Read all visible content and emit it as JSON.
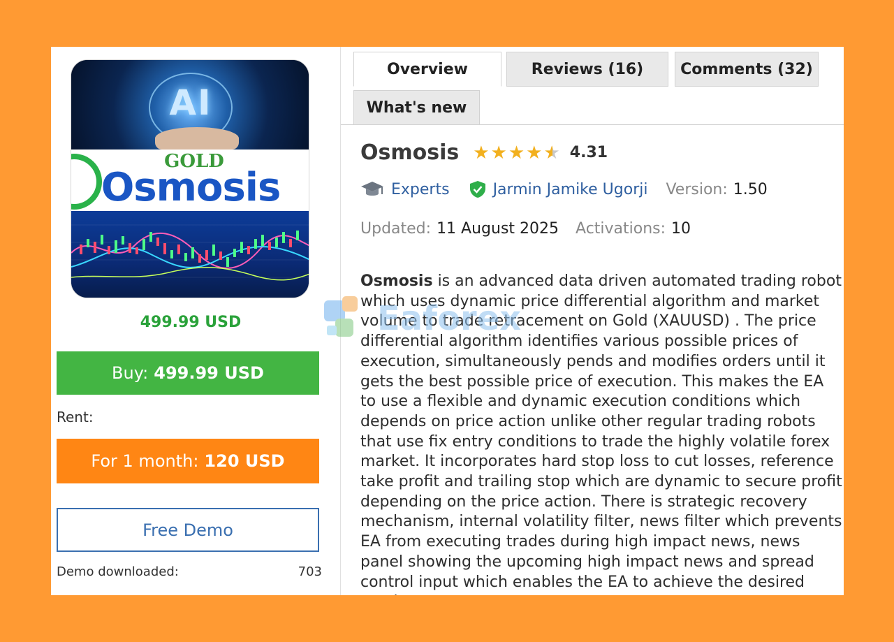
{
  "product": {
    "title": "Osmosis",
    "image": {
      "top_text": "AI",
      "brand_small": "GOLD",
      "brand_large": "Osmosis"
    },
    "rating": "4.31",
    "rating_value": 4.31,
    "category": "Experts",
    "author": "Jarmin Jamike Ugorji",
    "version_label": "Version:",
    "version": "1.50",
    "updated_label": "Updated:",
    "updated": "11 August 2025",
    "activations_label": "Activations:",
    "activations": "10"
  },
  "purchase": {
    "price": "499.99 USD",
    "buy_label": "Buy:",
    "buy_price": "499.99 USD",
    "rent_label": "Rent:",
    "rent_period": "For 1 month:",
    "rent_price": "120 USD",
    "demo_label": "Free Demo",
    "demo_downloaded_label": "Demo downloaded:",
    "demo_downloaded_count": "703"
  },
  "tabs": [
    {
      "label": "Overview",
      "active": true
    },
    {
      "label": "Reviews (16)",
      "active": false
    },
    {
      "label": "Comments (32)",
      "active": false
    },
    {
      "label": "What's new",
      "active": false
    }
  ],
  "description": {
    "lead": "Osmosis",
    "text": " is an advanced data driven automated trading robot which uses dynamic price differential algorithm and market volume to trade retracement on Gold (XAUUSD) . The price differential algorithm identifies various possible prices of execution, simultaneously pends and modifies orders until it gets the best possible price of execution. This makes the EA to use a flexible and dynamic execution conditions which depends on price action unlike other regular trading robots that use fix entry conditions to trade the highly volatile forex market. It incorporates hard stop loss to cut losses, reference take profit and trailing stop which are dynamic to secure profit depending on the price action. There is strategic recovery mechanism, internal volatility filter, news filter which prevents EA from executing trades during high impact news, news panel showing the upcoming high impact news and spread control input which enables the EA to achieve the desired results."
  },
  "watermark": {
    "text": "Eaforex"
  },
  "colors": {
    "background": "#ff9a33",
    "buy": "#43b543",
    "rent": "#ff8614",
    "price": "#2aa23a",
    "link": "#2f5fa0",
    "star": "#f2b01e"
  }
}
